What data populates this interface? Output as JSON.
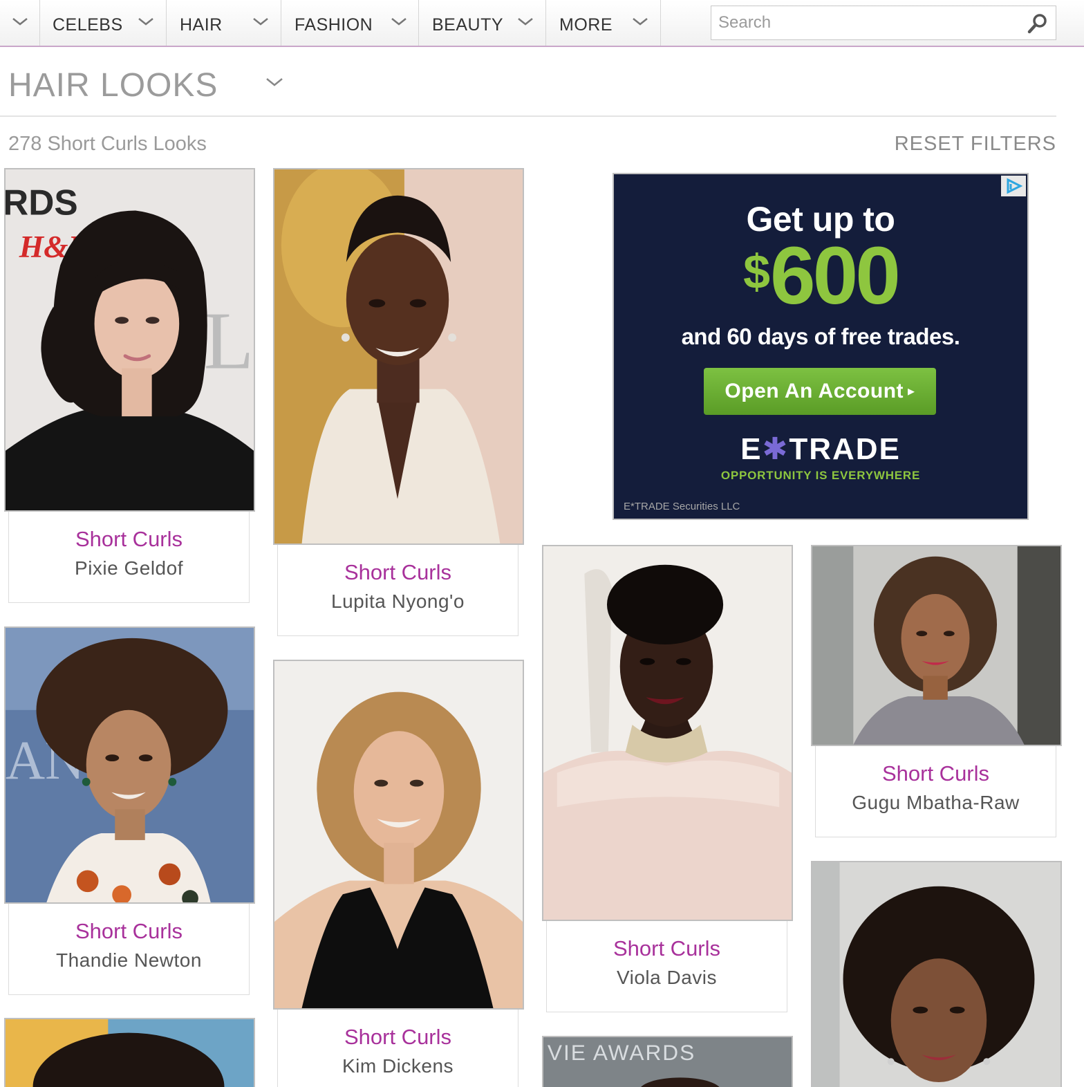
{
  "nav": {
    "items": [
      {
        "label": ""
      },
      {
        "label": "CELEBS"
      },
      {
        "label": "HAIR"
      },
      {
        "label": "FASHION"
      },
      {
        "label": "BEAUTY"
      },
      {
        "label": "MORE"
      }
    ],
    "search": {
      "placeholder": "Search"
    }
  },
  "page": {
    "title": "HAIR LOOKS",
    "result_count": "278 Short Curls Looks",
    "reset_label": "RESET FILTERS"
  },
  "cards": [
    {
      "style": "Short Curls",
      "name": "Pixie Geldof"
    },
    {
      "style": "Short Curls",
      "name": "Lupita Nyong'o"
    },
    {
      "style": "Short Curls",
      "name": "Viola Davis"
    },
    {
      "style": "Short Curls",
      "name": "Gugu Mbatha-Raw"
    },
    {
      "style": "Short Curls",
      "name": "Thandie Newton"
    },
    {
      "style": "Short Curls",
      "name": "Kim Dickens"
    },
    {
      "style": "",
      "name": ""
    },
    {
      "style": "",
      "name": ""
    },
    {
      "style": "",
      "name": ""
    }
  ],
  "photo_text": {
    "pixie_backdrop_1": "RDS",
    "pixie_backdrop_2": "H&M",
    "viola_next_backdrop": "VIE AWARDS"
  },
  "ad": {
    "headline": "Get up to",
    "currency": "$",
    "amount": "600",
    "subline": "and 60 days of free trades.",
    "cta_label": "Open An Account",
    "cta_arrow": "▸",
    "logo_pre": "E",
    "logo_star": "✱",
    "logo_post": "TRADE",
    "tagline": "OPPORTUNITY IS EVERYWHERE",
    "legal": "E*TRADE Securities LLC",
    "colors": {
      "background": "#141d3b",
      "green": "#8ec63f",
      "button": "#6cb034"
    }
  },
  "colors": {
    "accent": "#a8319b",
    "nav_underline": "#c9a6c9",
    "muted_text": "#9b9b9b"
  },
  "icons": {
    "search": "search-icon",
    "dropdown": "chevron-down-icon",
    "ad_choices": "ad-choices-icon"
  }
}
